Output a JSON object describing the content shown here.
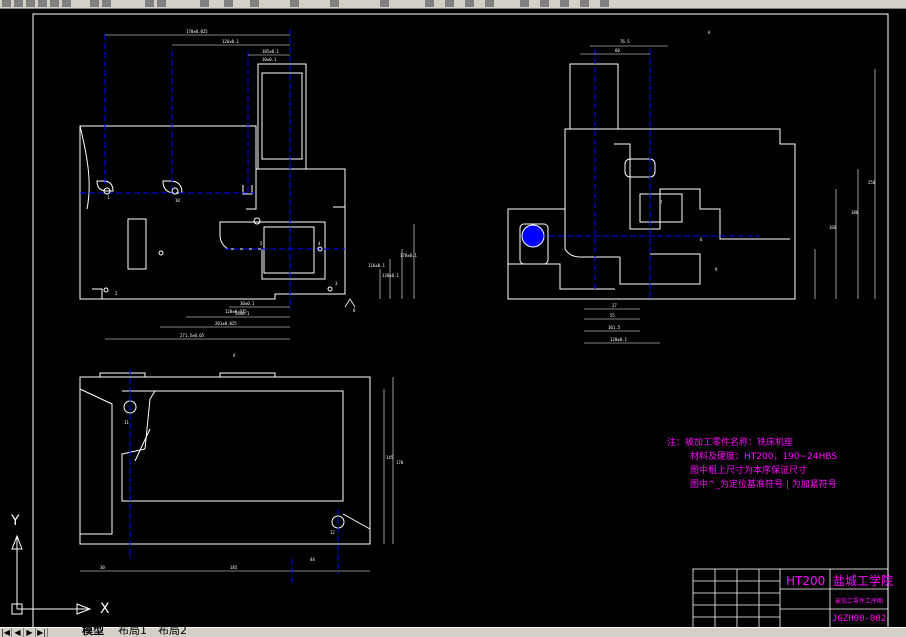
{
  "tabs": {
    "model": "模型",
    "layout1": "布局1",
    "layout2": "布局2"
  },
  "ucs": {
    "x_label": "X",
    "y_label": "Y"
  },
  "view_labels": {
    "top_view": "A",
    "side_view": "A"
  },
  "datum_marks": {
    "datum1": "1",
    "datum2": "2",
    "datum3": "3",
    "datum4": "4",
    "datum5": "5",
    "datum6": "6",
    "datum7": "7",
    "datum8": "8",
    "datum9": "9",
    "datum10": "10",
    "datum11": "11",
    "datum12": "12"
  },
  "dimensions": {
    "front_top1": "170±0.025",
    "front_top2": "126±0.1",
    "front_top3": "105±0.1",
    "front_top4": "10±0.1",
    "front_bot1": "30±0.1",
    "front_bot2": "58±0.1",
    "front_bot3": "120±0.025",
    "front_bot4": "201±0.025",
    "front_bot5": "271.5±0.05",
    "front_right1": "116±0.1",
    "front_right2": "178±0.1",
    "front_right3": "138±0.1",
    "side_top1": "76.5",
    "side_top2": "60",
    "side_bot1": "27",
    "side_bot2": "55",
    "side_bot3": "101.5",
    "side_bot4": "120±0.1",
    "side_right1": "250",
    "side_right2": "180",
    "side_right3": "160",
    "bottom_width": "185",
    "bottom_left": "30",
    "bottom_mid": "44",
    "bottom_h1": "145",
    "bottom_h2": "170"
  },
  "notes": {
    "title": "注：被加工零件名称：铣床机座",
    "line1": "材料及硬度：HT200，190~24HBS",
    "line2": "图中粗上尺寸为本序保证尺寸",
    "line3": "图中^_为定位基准符号 | 为加紧符号"
  },
  "title_block": {
    "material": "HT200",
    "school": "盐城工学院",
    "drawing_name": "被加工零件工序图",
    "drawing_no": "JGZH00-002"
  },
  "colors": {
    "outline": "#ffffff",
    "center": "#0000ff",
    "dim": "#ffffff",
    "note": "#ff00ff",
    "frame": "#ffffff"
  }
}
